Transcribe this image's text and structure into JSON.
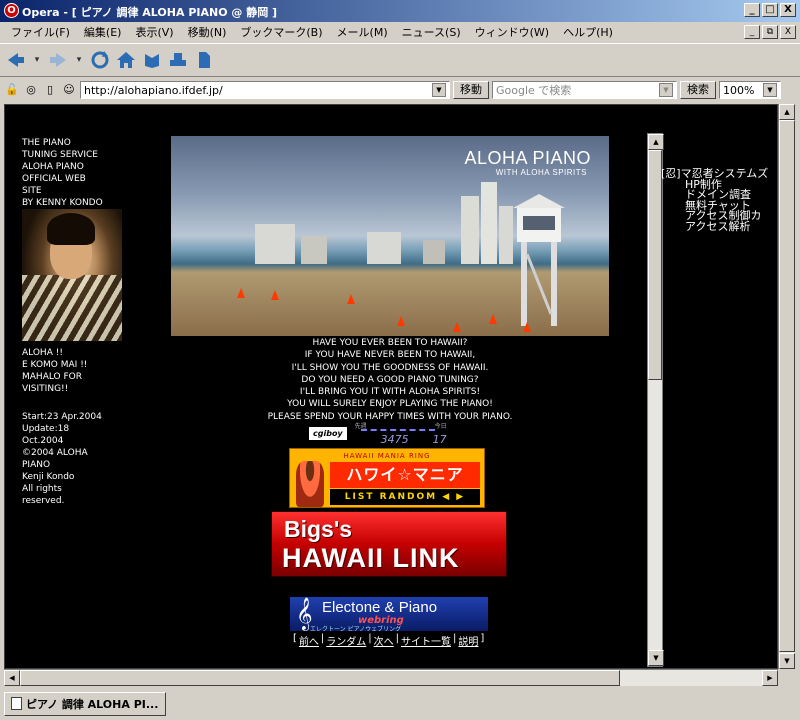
{
  "window": {
    "title": "Opera - [ ピアノ 調律 ALOHA PIANO @ 静岡 ]",
    "logo_glyph": "O",
    "buttons": [
      "_",
      "□",
      "X"
    ],
    "mdi_buttons": [
      "_",
      "⧉",
      "X"
    ]
  },
  "menu": [
    "ファイル(F)",
    "編集(E)",
    "表示(V)",
    "移動(N)",
    "ブックマーク(B)",
    "メール(M)",
    "ニュース(S)",
    "ウィンドウ(W)",
    "ヘルプ(H)"
  ],
  "navbar_icons": [
    "back-icon",
    "forward-icon",
    "reload-icon",
    "home-icon",
    "bookmarks-icon",
    "print-icon",
    "page-icon"
  ],
  "address": {
    "url": "http://alohapiano.ifdef.jp/",
    "go_label": "移動",
    "search_placeholder": "Google で検索",
    "search_label": "検索",
    "zoom": "100%"
  },
  "sidebar": {
    "intro": [
      "THE PIANO",
      "TUNING SERVICE",
      "ALOHA PIANO",
      "OFFICIAL WEB",
      "SITE",
      "BY KENNY KONDO"
    ],
    "greeting": [
      "ALOHA !!",
      "E KOMO MAI !!",
      "MAHALO FOR",
      "VISITING!!"
    ],
    "info": [
      "Start:23 Apr.2004",
      "Update:18",
      "Oct.2004",
      "©2004 ALOHA",
      "PIANO",
      "Kenji Kondo",
      "All rights",
      "reserved."
    ]
  },
  "hero": {
    "title": "ALOHA PIANO",
    "subtitle": "WITH ALOHA SPIRITS"
  },
  "message": [
    "HAVE YOU EVER BEEN TO HAWAII?",
    "IF YOU HAVE NEVER BEEN TO  HAWAII,",
    "I'LL SHOW YOU THE GOODNESS OF HAWAII.",
    "DO YOU NEED A GOOD PIANO TUNING?",
    "I'LL BRING YOU IT WITH ALOHA SPIRITS!",
    "YOU WILL SURELY ENJOY PLAYING THE PIANO!",
    "PLEASE SPEND YOUR HAPPY TIMES WITH YOUR PIANO."
  ],
  "counter": {
    "logo": "cgiboy",
    "label_prev": "先週",
    "label_today": "今日",
    "week": "3475",
    "today": "17"
  },
  "banners": {
    "mania_top": "HAWAII MANIA RING",
    "mania_mid": "ハワイ☆マニア",
    "mania_bot": "LIST RANDOM ◀ ▶",
    "bigs_line1": "Bigs's",
    "bigs_line2": "HAWAII LINK",
    "electone_clef": "𝄞",
    "electone_line1": "Electone & Piano",
    "electone_line2": "webring",
    "electone_line3": "エレクトーン                ピアノウェブリング"
  },
  "webring_nav": {
    "open": "[",
    "links": [
      "前へ",
      "ランダム",
      "次へ",
      "サイト一覧",
      "説明"
    ],
    "sep": "|",
    "close": "]"
  },
  "ninja": {
    "header": "[忍]マ忍者システムズ",
    "items": [
      "HP制作",
      "ドメイン調査",
      "無料チャット",
      "アクセス制御カ",
      "アクセス解析"
    ]
  },
  "status": {
    "tab_label": "ピアノ 調律 ALOHA PI..."
  },
  "colors": {
    "page_bg": "#000000",
    "title_bar": "#0a246a",
    "chrome": "#d4d0c8"
  }
}
